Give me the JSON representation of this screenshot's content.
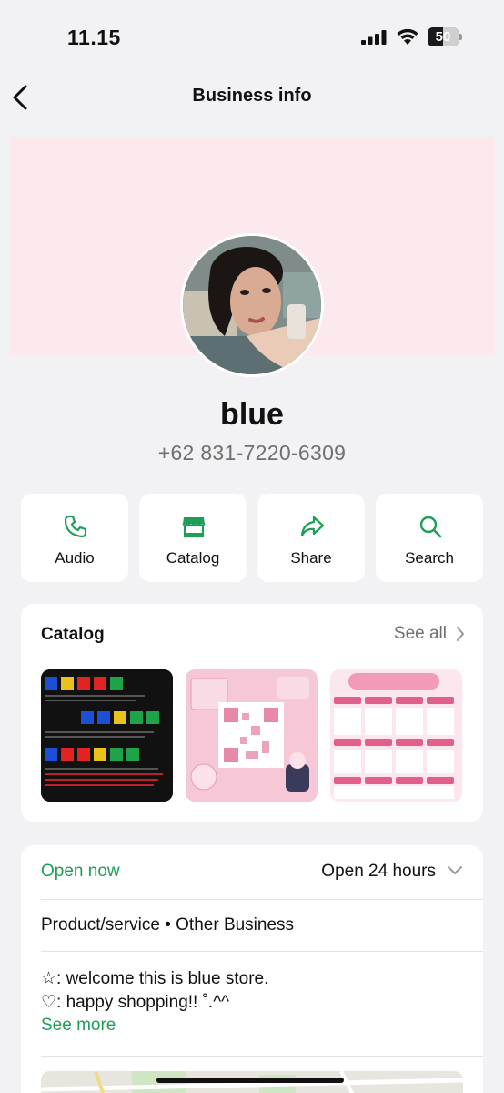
{
  "status_bar": {
    "time": "11.15",
    "battery_level": "50",
    "battery_fraction": 0.5
  },
  "nav": {
    "title": "Business info",
    "back_icon": "chevron-left-icon"
  },
  "profile": {
    "name": "blue",
    "phone": "+62 831-7220-6309",
    "cover_color": "#fce9ee"
  },
  "actions": [
    {
      "label": "Audio",
      "icon": "phone-icon"
    },
    {
      "label": "Catalog",
      "icon": "store-icon"
    },
    {
      "label": "Share",
      "icon": "share-arrow-icon"
    },
    {
      "label": "Search",
      "icon": "search-icon"
    }
  ],
  "catalog": {
    "title": "Catalog",
    "see_all": "See all",
    "items": [
      {
        "name": "catalog-item-profiles"
      },
      {
        "name": "catalog-item-pink-qr"
      },
      {
        "name": "catalog-item-pricelist"
      }
    ]
  },
  "info": {
    "status": "Open now",
    "hours": "Open 24 hours",
    "category": "Product/service • Other Business",
    "description_line1": "☆: welcome this is blue store.",
    "description_line2": "♡: happy shopping!! ˚.^^",
    "see_more": "See more"
  },
  "colors": {
    "accent_green": "#1e9e57",
    "background": "#f2f2f4"
  }
}
